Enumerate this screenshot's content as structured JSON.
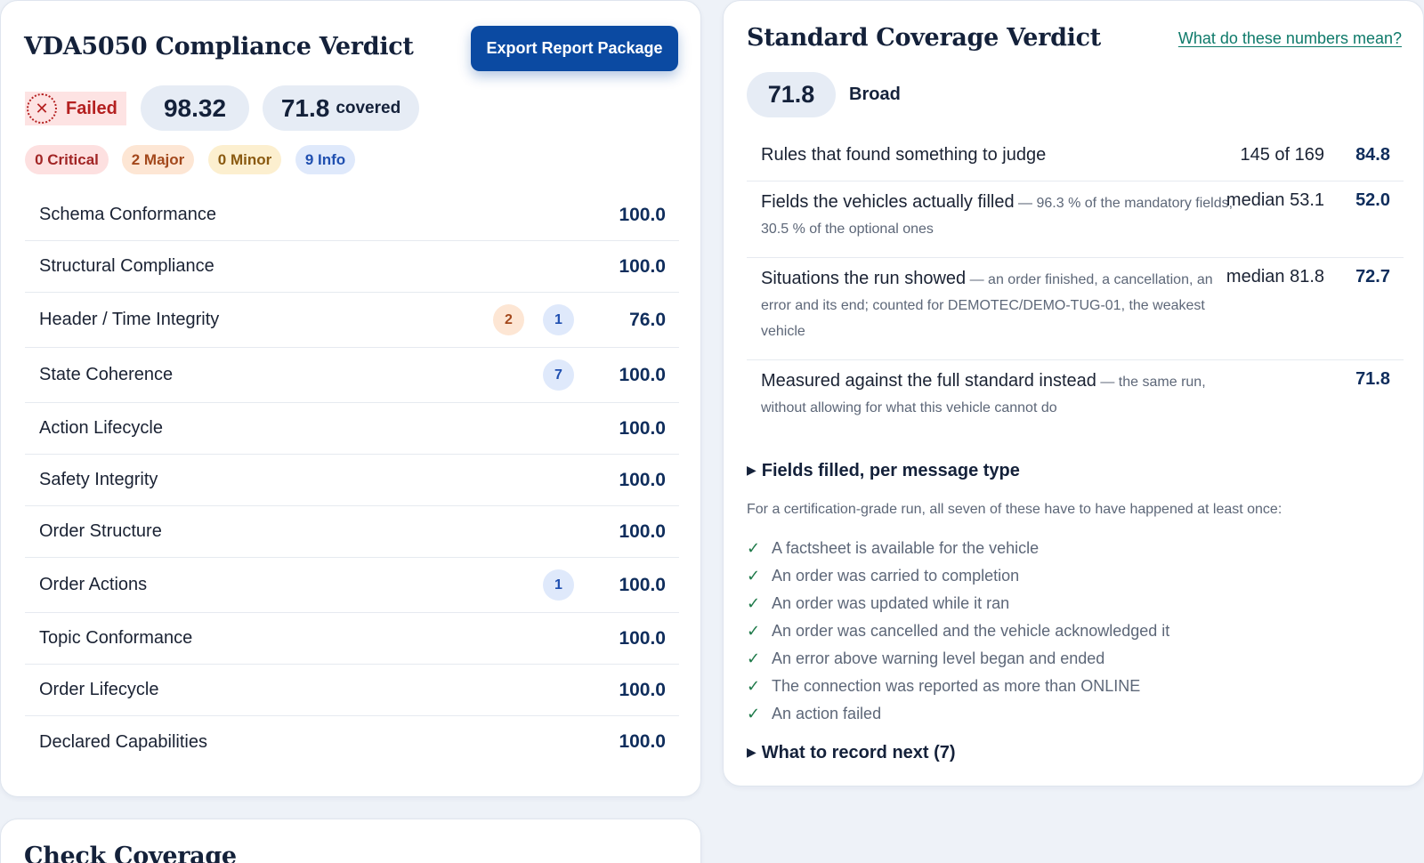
{
  "compliance": {
    "title": "VDA5050 Compliance Verdict",
    "export_label": "Export Report Package",
    "verdict": {
      "label": "Failed",
      "icon": "x-circle-icon",
      "color": "#b42020"
    },
    "score": "98.32",
    "covered_value": "71.8",
    "covered_label": "covered",
    "severity": {
      "critical": "0 Critical",
      "major": "2 Major",
      "minor": "0 Minor",
      "info": "9 Info"
    },
    "checks": [
      {
        "name": "Schema Conformance",
        "major": "",
        "info": "",
        "score": "100.0"
      },
      {
        "name": "Structural Compliance",
        "major": "",
        "info": "",
        "score": "100.0"
      },
      {
        "name": "Header / Time Integrity",
        "major": "2",
        "info": "1",
        "score": "76.0"
      },
      {
        "name": "State Coherence",
        "major": "",
        "info": "7",
        "score": "100.0"
      },
      {
        "name": "Action Lifecycle",
        "major": "",
        "info": "",
        "score": "100.0"
      },
      {
        "name": "Safety Integrity",
        "major": "",
        "info": "",
        "score": "100.0"
      },
      {
        "name": "Order Structure",
        "major": "",
        "info": "",
        "score": "100.0"
      },
      {
        "name": "Order Actions",
        "major": "",
        "info": "1",
        "score": "100.0"
      },
      {
        "name": "Topic Conformance",
        "major": "",
        "info": "",
        "score": "100.0"
      },
      {
        "name": "Order Lifecycle",
        "major": "",
        "info": "",
        "score": "100.0"
      },
      {
        "name": "Declared Capabilities",
        "major": "",
        "info": "",
        "score": "100.0"
      }
    ]
  },
  "coverage": {
    "title": "Standard Coverage Verdict",
    "help_link": "What do these numbers mean?",
    "score": "71.8",
    "label": "Broad",
    "metrics": [
      {
        "title": "Rules that found something to judge",
        "desc": "",
        "median": "145 of 169",
        "score": "84.8"
      },
      {
        "title": "Fields the vehicles actually filled",
        "desc": "— 96.3 % of the mandatory fields, 30.5 % of the optional ones",
        "median": "median 53.1",
        "score": "52.0"
      },
      {
        "title": "Situations the run showed",
        "desc": "— an order finished, a cancellation, an error and its end; counted for DEMOTEC/DEMO-TUG-01, the weakest vehicle",
        "median": "median 81.8",
        "score": "72.7"
      },
      {
        "title": "Measured against the full standard instead",
        "desc": "— the same run, without allowing for what this vehicle cannot do",
        "median": "",
        "score": "71.8"
      }
    ],
    "fields_disclosure": "Fields filled, per message type",
    "requirements_intro": "For a certification-grade run, all seven of these have to have happened at least once:",
    "requirements": [
      "A factsheet is available for the vehicle",
      "An order was carried to completion",
      "An order was updated while it ran",
      "An order was cancelled and the vehicle acknowledged it",
      "An error above warning level began and ended",
      "The connection was reported as more than ONLINE",
      "An action failed"
    ],
    "next_disclosure": "What to record next (7)"
  },
  "check_coverage": {
    "title": "Check Coverage"
  },
  "colors": {
    "accent": "#0b4aa2",
    "fail": "#b42020",
    "ok": "#1f7a4a",
    "link": "#0e7a6a"
  }
}
